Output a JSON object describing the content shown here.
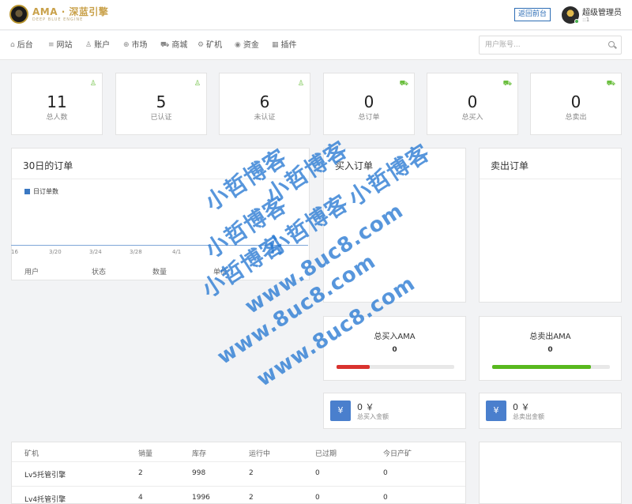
{
  "header": {
    "logo_text": "AMA · 深蓝引擎",
    "logo_subtext": "DEEP BLUE ENGINE",
    "back_button": "返回前台",
    "user_name": "超级管理员",
    "user_id": "::1"
  },
  "nav": {
    "items": [
      {
        "label": "后台",
        "icon": "home-icon"
      },
      {
        "label": "网站",
        "icon": "list-icon"
      },
      {
        "label": "账户",
        "icon": "user-icon"
      },
      {
        "label": "市场",
        "icon": "globe-icon"
      },
      {
        "label": "商城",
        "icon": "cart-icon"
      },
      {
        "label": "矿机",
        "icon": "settings-icon"
      },
      {
        "label": "资金",
        "icon": "coin-icon"
      },
      {
        "label": "插件",
        "icon": "grid-icon"
      }
    ],
    "search_placeholder": "用户账号..."
  },
  "stats": [
    {
      "value": "11",
      "label": "总人数",
      "icon": "user-icon"
    },
    {
      "value": "5",
      "label": "已认证",
      "icon": "user-icon"
    },
    {
      "value": "6",
      "label": "未认证",
      "icon": "user-icon"
    },
    {
      "value": "0",
      "label": "总订单",
      "icon": "cart-icon"
    },
    {
      "value": "0",
      "label": "总买入",
      "icon": "cart-icon"
    },
    {
      "value": "0",
      "label": "总卖出",
      "icon": "cart-icon"
    }
  ],
  "orders_panel": {
    "title": "30日的订单",
    "legend": "日订单数",
    "ticks": [
      "16",
      "3/20",
      "3/24",
      "3/28",
      "4/1"
    ],
    "columns": [
      "用户",
      "状态",
      "数量",
      "单价"
    ]
  },
  "buy_panel": {
    "title": "买入订单"
  },
  "sell_panel": {
    "title": "卖出订单"
  },
  "totals": {
    "buy_title": "总买入AMA",
    "buy_value": "0",
    "buy_fill": 0.28,
    "buy_color": "#d9322e",
    "sell_title": "总卖出AMA",
    "sell_value": "0",
    "sell_fill": 0.84,
    "sell_color": "#58b81e"
  },
  "money": {
    "buy_value": "0 ￥",
    "buy_label": "总买入金额",
    "sell_value": "0 ￥",
    "sell_label": "总卖出金额",
    "icon": "yen-icon",
    "icon_glyph": "¥"
  },
  "miners_table": {
    "columns": [
      "矿机",
      "销量",
      "库存",
      "运行中",
      "已过期",
      "今日产矿"
    ],
    "rows": [
      [
        "Lv5托管引擎",
        "2",
        "998",
        "2",
        "0",
        "0"
      ],
      [
        "Lv4托管引擎",
        "4",
        "1996",
        "2",
        "0",
        "0"
      ]
    ]
  },
  "watermark": {
    "cn": "小哲博客",
    "url": "www.8uc8.com"
  }
}
